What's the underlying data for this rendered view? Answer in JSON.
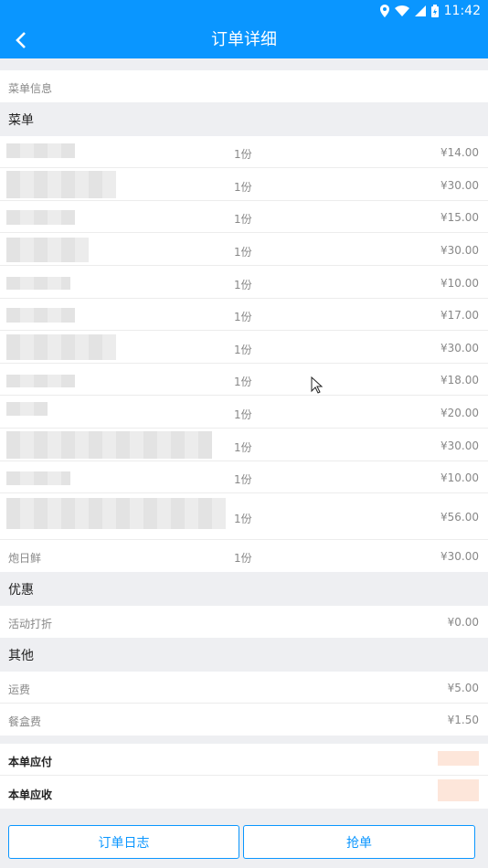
{
  "status": {
    "time": "11:42"
  },
  "nav": {
    "title": "订单详细"
  },
  "info_label": "菜单信息",
  "menu_section": "菜单",
  "menu_items": [
    {
      "qty": "1份",
      "price": "¥14.00"
    },
    {
      "qty": "1份",
      "price": "¥30.00"
    },
    {
      "qty": "1份",
      "price": "¥15.00"
    },
    {
      "qty": "1份",
      "price": "¥30.00"
    },
    {
      "qty": "1份",
      "price": "¥10.00"
    },
    {
      "qty": "1份",
      "price": "¥17.00"
    },
    {
      "qty": "1份",
      "price": "¥30.00"
    },
    {
      "qty": "1份",
      "price": "¥18.00"
    },
    {
      "qty": "1份",
      "price": "¥20.00"
    },
    {
      "qty": "1份",
      "price": "¥30.00"
    },
    {
      "qty": "1份",
      "price": "¥10.00"
    },
    {
      "qty": "1份",
      "price": "¥56.00"
    },
    {
      "name": "炮日鲜",
      "qty": "1份",
      "price": "¥30.00"
    }
  ],
  "discount_section": "优惠",
  "discount": {
    "label": "活动打折",
    "value": "¥0.00"
  },
  "other_section": "其他",
  "fees": [
    {
      "label": "运费",
      "value": "¥5.00"
    },
    {
      "label": "餐盒费",
      "value": "¥1.50"
    }
  ],
  "totals": {
    "payable_label": "本单应付",
    "receivable_label": "本单应收"
  },
  "buttons": {
    "log": "订单日志",
    "grab": "抢单"
  },
  "colors": {
    "primary": "#0a96ff",
    "section_bg": "#eeeff2",
    "peach_redacted": "#fde6da"
  }
}
